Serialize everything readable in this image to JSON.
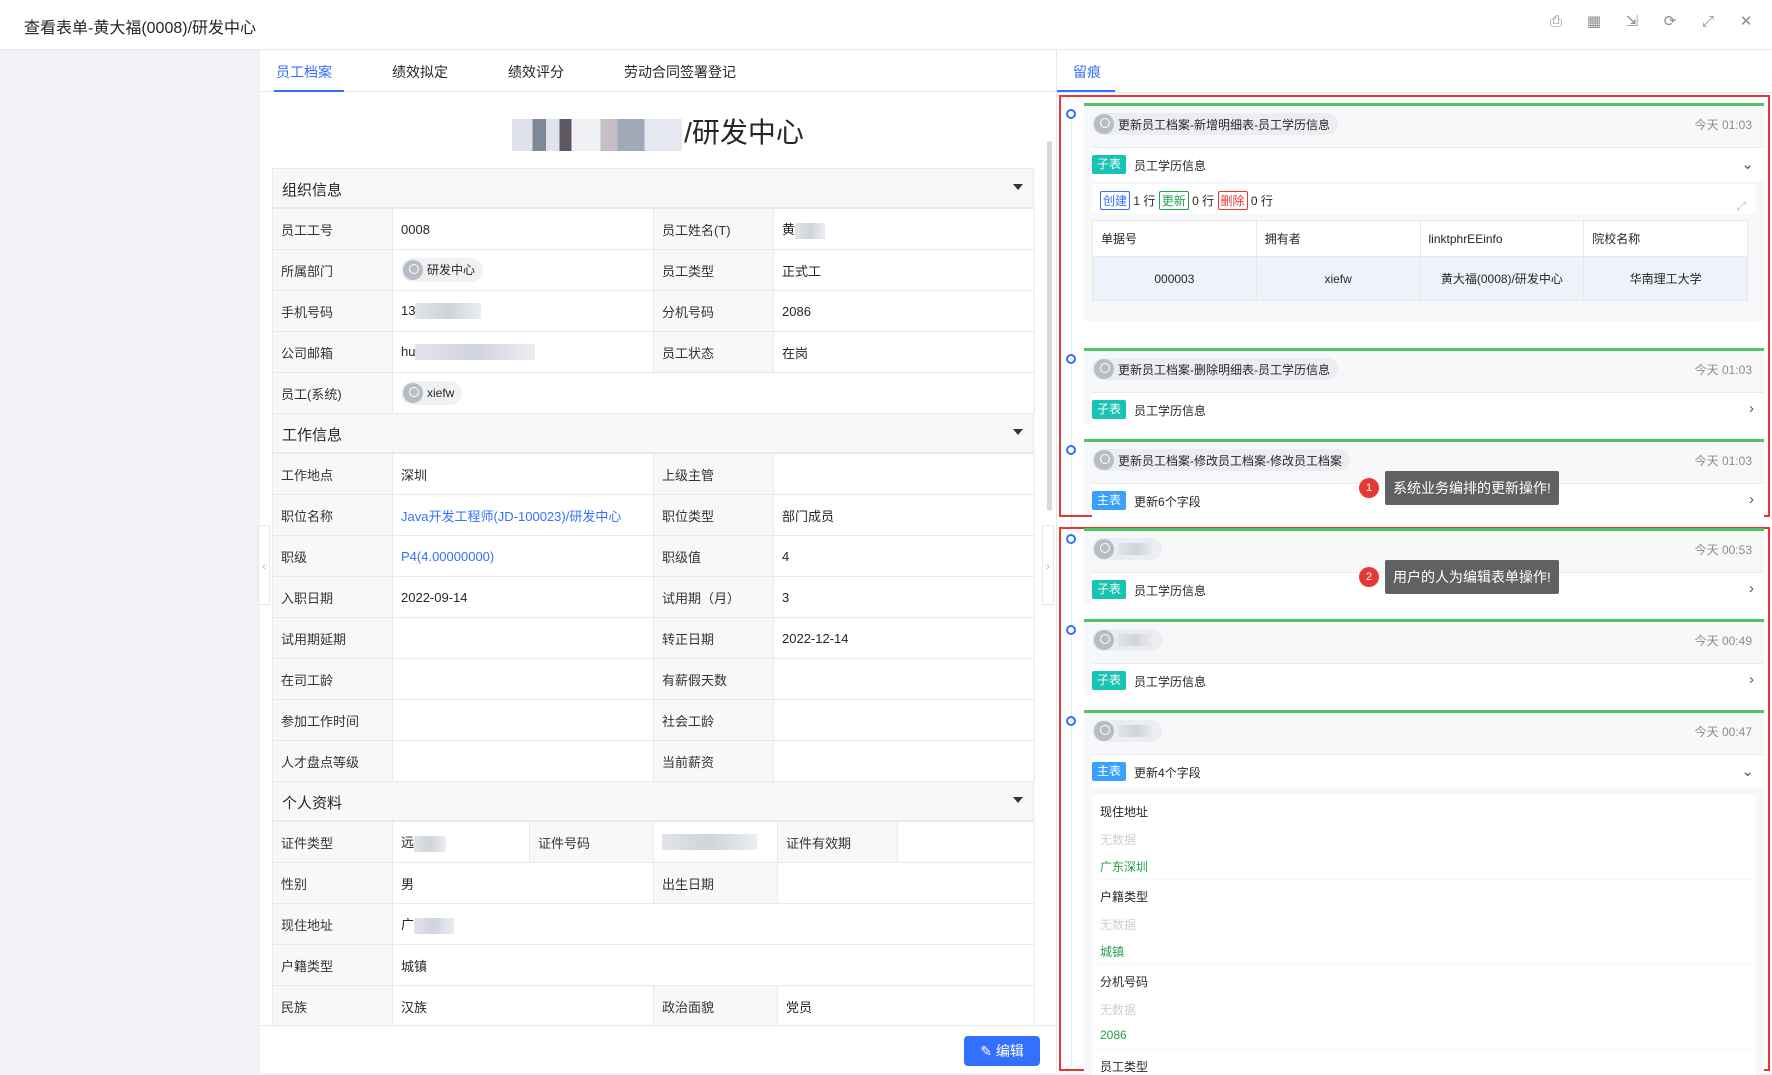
{
  "window": {
    "title": "查看表单-黄大福(0008)/研发中心",
    "icons": [
      "print-icon",
      "qrcode-icon",
      "export-icon",
      "refresh-icon",
      "fullscreen-icon",
      "close-icon"
    ]
  },
  "tabs": [
    "员工档案",
    "绩效拟定",
    "绩效评分",
    "劳动合同签署登记"
  ],
  "form": {
    "heading_suffix": "/研发中心",
    "sections": {
      "org": "组织信息",
      "work": "工作信息",
      "personal": "个人资料"
    },
    "org": {
      "emp_no_label": "员工工号",
      "emp_no": "0008",
      "emp_name_label": "员工姓名(T)",
      "emp_name_prefix": "黄",
      "dept_label": "所属部门",
      "dept": "研发中心",
      "emp_type_label": "员工类型",
      "emp_type": "正式工",
      "phone_label": "手机号码",
      "phone_prefix": "13",
      "ext_label": "分机号码",
      "ext": "2086",
      "email_label": "公司邮箱",
      "email_prefix": "hu",
      "status_label": "员工状态",
      "status": "在岗",
      "sys_user_label": "员工(系统)",
      "sys_user": "xiefw"
    },
    "work": {
      "location_label": "工作地点",
      "location": "深圳",
      "manager_label": "上级主管",
      "position_label": "职位名称",
      "position": "Java开发工程师(JD-100023)/研发中心",
      "position_type_label": "职位类型",
      "position_type": "部门成员",
      "level_label": "职级",
      "level": "P4(4.00000000)",
      "level_value_label": "职级值",
      "level_value": "4",
      "join_date_label": "入职日期",
      "join_date": "2022-09-14",
      "probation_label": "试用期（月）",
      "probation": "3",
      "probation_ext_label": "试用期延期",
      "regular_date_label": "转正日期",
      "regular_date": "2022-12-14",
      "tenure_label": "在司工龄",
      "paid_leave_label": "有薪假天数",
      "work_start_label": "参加工作时间",
      "social_age_label": "社会工龄",
      "talent_label": "人才盘点等级",
      "salary_label": "当前薪资"
    },
    "personal": {
      "id_type_label": "证件类型",
      "id_type_prefix": "远",
      "id_no_label": "证件号码",
      "id_valid_label": "证件有效期",
      "gender_label": "性别",
      "gender": "男",
      "birth_label": "出生日期",
      "address_label": "现住地址",
      "address_prefix": "广",
      "hukou_label": "户籍类型",
      "hukou": "城镇",
      "ethnic_label": "民族",
      "ethnic": "汉族",
      "political_label": "政治面貌",
      "political": "党员"
    }
  },
  "footer": {
    "edit_label": "编辑"
  },
  "trail": {
    "tab": "留痕",
    "entries": [
      {
        "title": "更新员工档案-新增明细表-员工学历信息",
        "time": "今天 01:03",
        "tag": "子表",
        "desc": "员工学历信息",
        "stats": {
          "create": "创建",
          "create_n": "1",
          "update": "更新",
          "update_n": "0",
          "delete": "删除",
          "delete_n": "0",
          "unit": "行"
        },
        "subtable": {
          "headers": [
            "单据号",
            "拥有者",
            "linktphrEEinfo",
            "院校名称"
          ],
          "row": [
            "000003",
            "xiefw",
            "黄大福(0008)/研发中心",
            "华南理工大学"
          ]
        }
      },
      {
        "title": "更新员工档案-删除明细表-员工学历信息",
        "time": "今天 01:03",
        "tag": "子表",
        "desc": "员工学历信息"
      },
      {
        "title": "更新员工档案-修改员工档案-修改员工档案",
        "time": "今天 01:03",
        "tag": "主表",
        "desc": "更新6个字段"
      },
      {
        "time": "今天 00:53",
        "tag": "子表",
        "desc": "员工学历信息"
      },
      {
        "time": "今天 00:49",
        "tag": "子表",
        "desc": "员工学历信息"
      },
      {
        "time": "今天 00:47",
        "tag": "主表",
        "desc": "更新4个字段",
        "fields": [
          {
            "label": "现住地址",
            "old": "无数据",
            "new": "广东深圳"
          },
          {
            "label": "户籍类型",
            "old": "无数据",
            "new": "城镇"
          },
          {
            "label": "分机号码",
            "old": "无数据",
            "new": "2086"
          },
          {
            "label": "员工类型"
          }
        ]
      }
    ],
    "callouts": [
      {
        "num": "1",
        "text": "系统业务编排的更新操作!"
      },
      {
        "num": "2",
        "text": "用户的人为编辑表单操作!"
      }
    ]
  },
  "colors": {
    "accent": "#3370ff",
    "highlight_border": "#e53935",
    "card_top": "#52c468",
    "sub_tag": "#17c3b2",
    "main_tag": "#3aa0ff"
  }
}
